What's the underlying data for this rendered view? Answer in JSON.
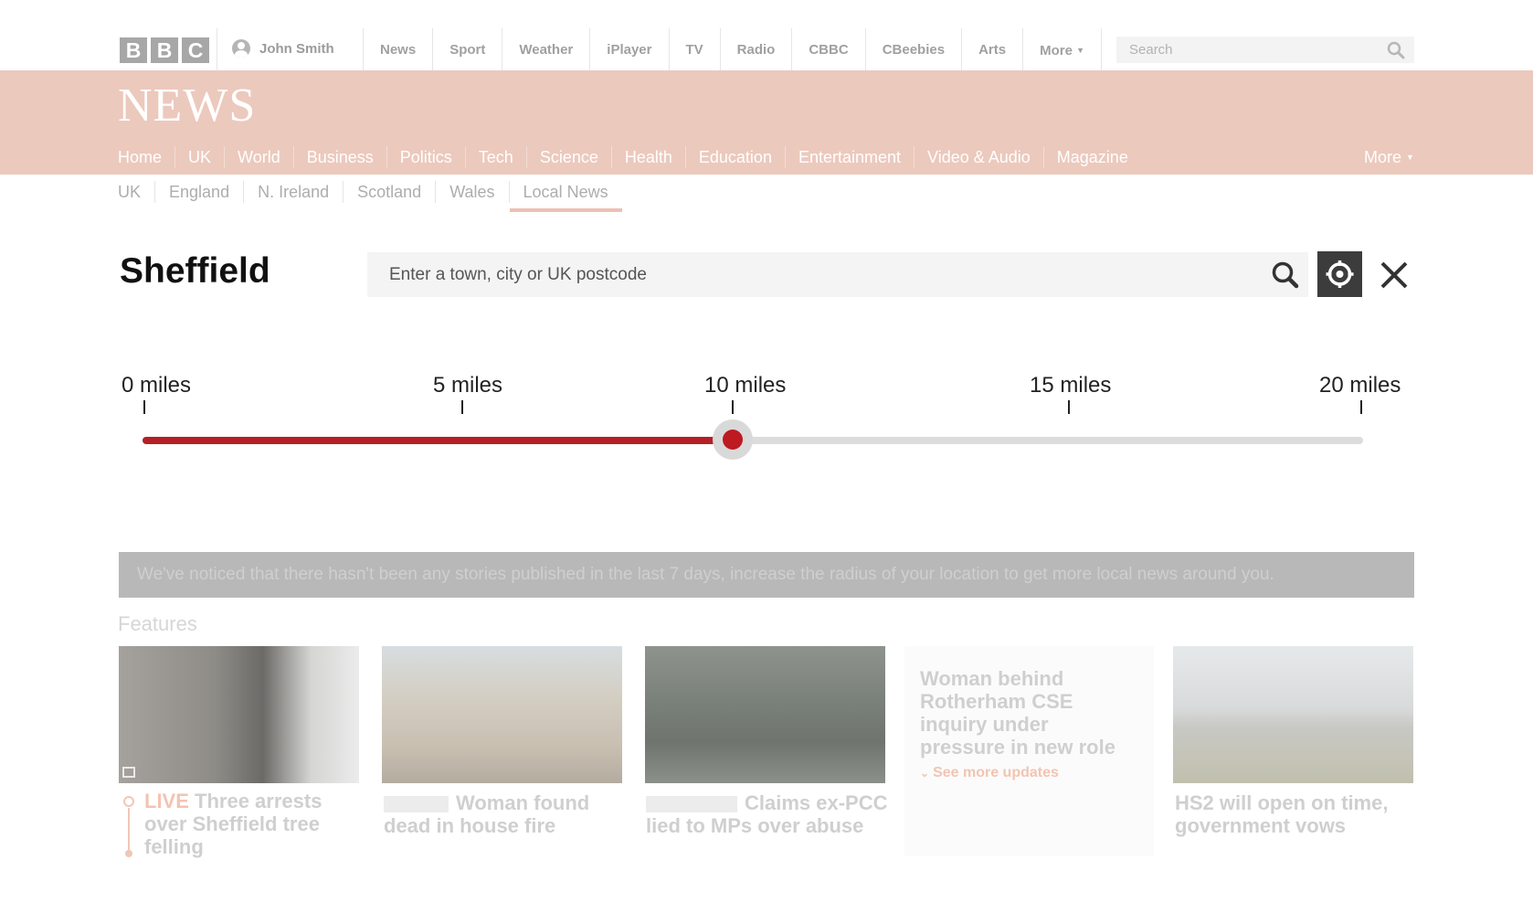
{
  "bbc_bar": {
    "logo": [
      "B",
      "B",
      "B",
      "C"
    ],
    "user_name": "John Smith",
    "nav": [
      "News",
      "Sport",
      "Weather",
      "iPlayer",
      "TV",
      "Radio",
      "CBBC",
      "CBeebies",
      "Arts",
      "More"
    ],
    "search_placeholder": "Search"
  },
  "news_header": {
    "logo": "NEWS",
    "nav": [
      "Home",
      "UK",
      "World",
      "Business",
      "Politics",
      "Tech",
      "Science",
      "Health",
      "Education",
      "Entertainment",
      "Video & Audio",
      "Magazine"
    ],
    "more": "More",
    "active": "UK"
  },
  "sub_nav": {
    "items": [
      "UK",
      "England",
      "N. Ireland",
      "Scotland",
      "Wales",
      "Local News"
    ],
    "active": "Local News"
  },
  "location": {
    "title": "Sheffield",
    "input_placeholder": "Enter a town, city or UK postcode"
  },
  "radius": {
    "labels": [
      "0 miles",
      "5 miles",
      "10 miles",
      "15 miles",
      "20 miles"
    ],
    "min": 0,
    "max": 20,
    "value": 10,
    "fill_color": "#b61f27"
  },
  "notice": "We've noticed that there hasn't been any stories published in the last 7 days, increase the radius of your location to get more local news around you.",
  "features": {
    "heading": "Features",
    "cards": [
      {
        "live_label": "LIVE",
        "headline": "Three arrests over Sheffield tree felling"
      },
      {
        "headline": "Woman found dead in house fire"
      },
      {
        "headline": "Claims ex-PCC lied to MPs over abuse"
      },
      {
        "headline": "Woman behind Rotherham CSE inquiry under pressure in new role",
        "see_more": "See more updates"
      },
      {
        "headline": "HS2 will open on time, government vows"
      }
    ]
  },
  "colors": {
    "accent": "#b61f27",
    "news_band": "#ecc9bd"
  }
}
